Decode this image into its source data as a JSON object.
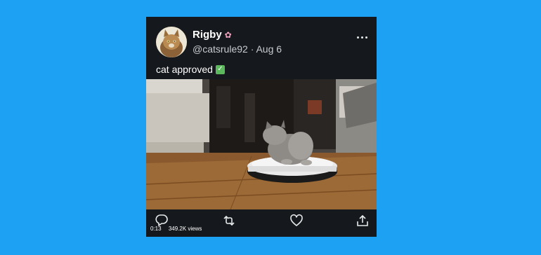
{
  "tweet": {
    "display_name": "Rigby",
    "name_emoji": "✿",
    "handle_date": "@catsrule92 · Aug 6",
    "text": "cat approved",
    "text_emoji": "✓",
    "video": {
      "time": "0:13",
      "views": "349.2K views"
    }
  },
  "icons": {
    "more": "more-horizontal-icon",
    "reply": "reply-icon",
    "retweet": "retweet-icon",
    "like": "heart-icon",
    "share": "share-icon"
  },
  "colors": {
    "background": "#1da1f2",
    "card": "#15181c",
    "text": "#e7e9ea"
  }
}
